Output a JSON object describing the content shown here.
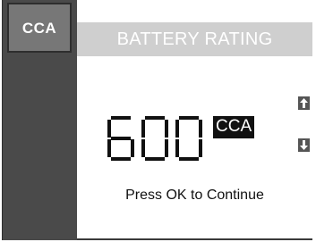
{
  "sidebar": {
    "key_label": "CCA"
  },
  "header": {
    "title": "BATTERY RATING"
  },
  "rating": {
    "value": "600",
    "unit": "CCA",
    "up_icon": "arrow-up-icon",
    "down_icon": "arrow-down-icon"
  },
  "prompt": "Press OK to Continue",
  "colors": {
    "sidebar": "#4a4a4a",
    "key": "#777777",
    "title_bar": "#cfcfcf",
    "segment": "#111111"
  }
}
